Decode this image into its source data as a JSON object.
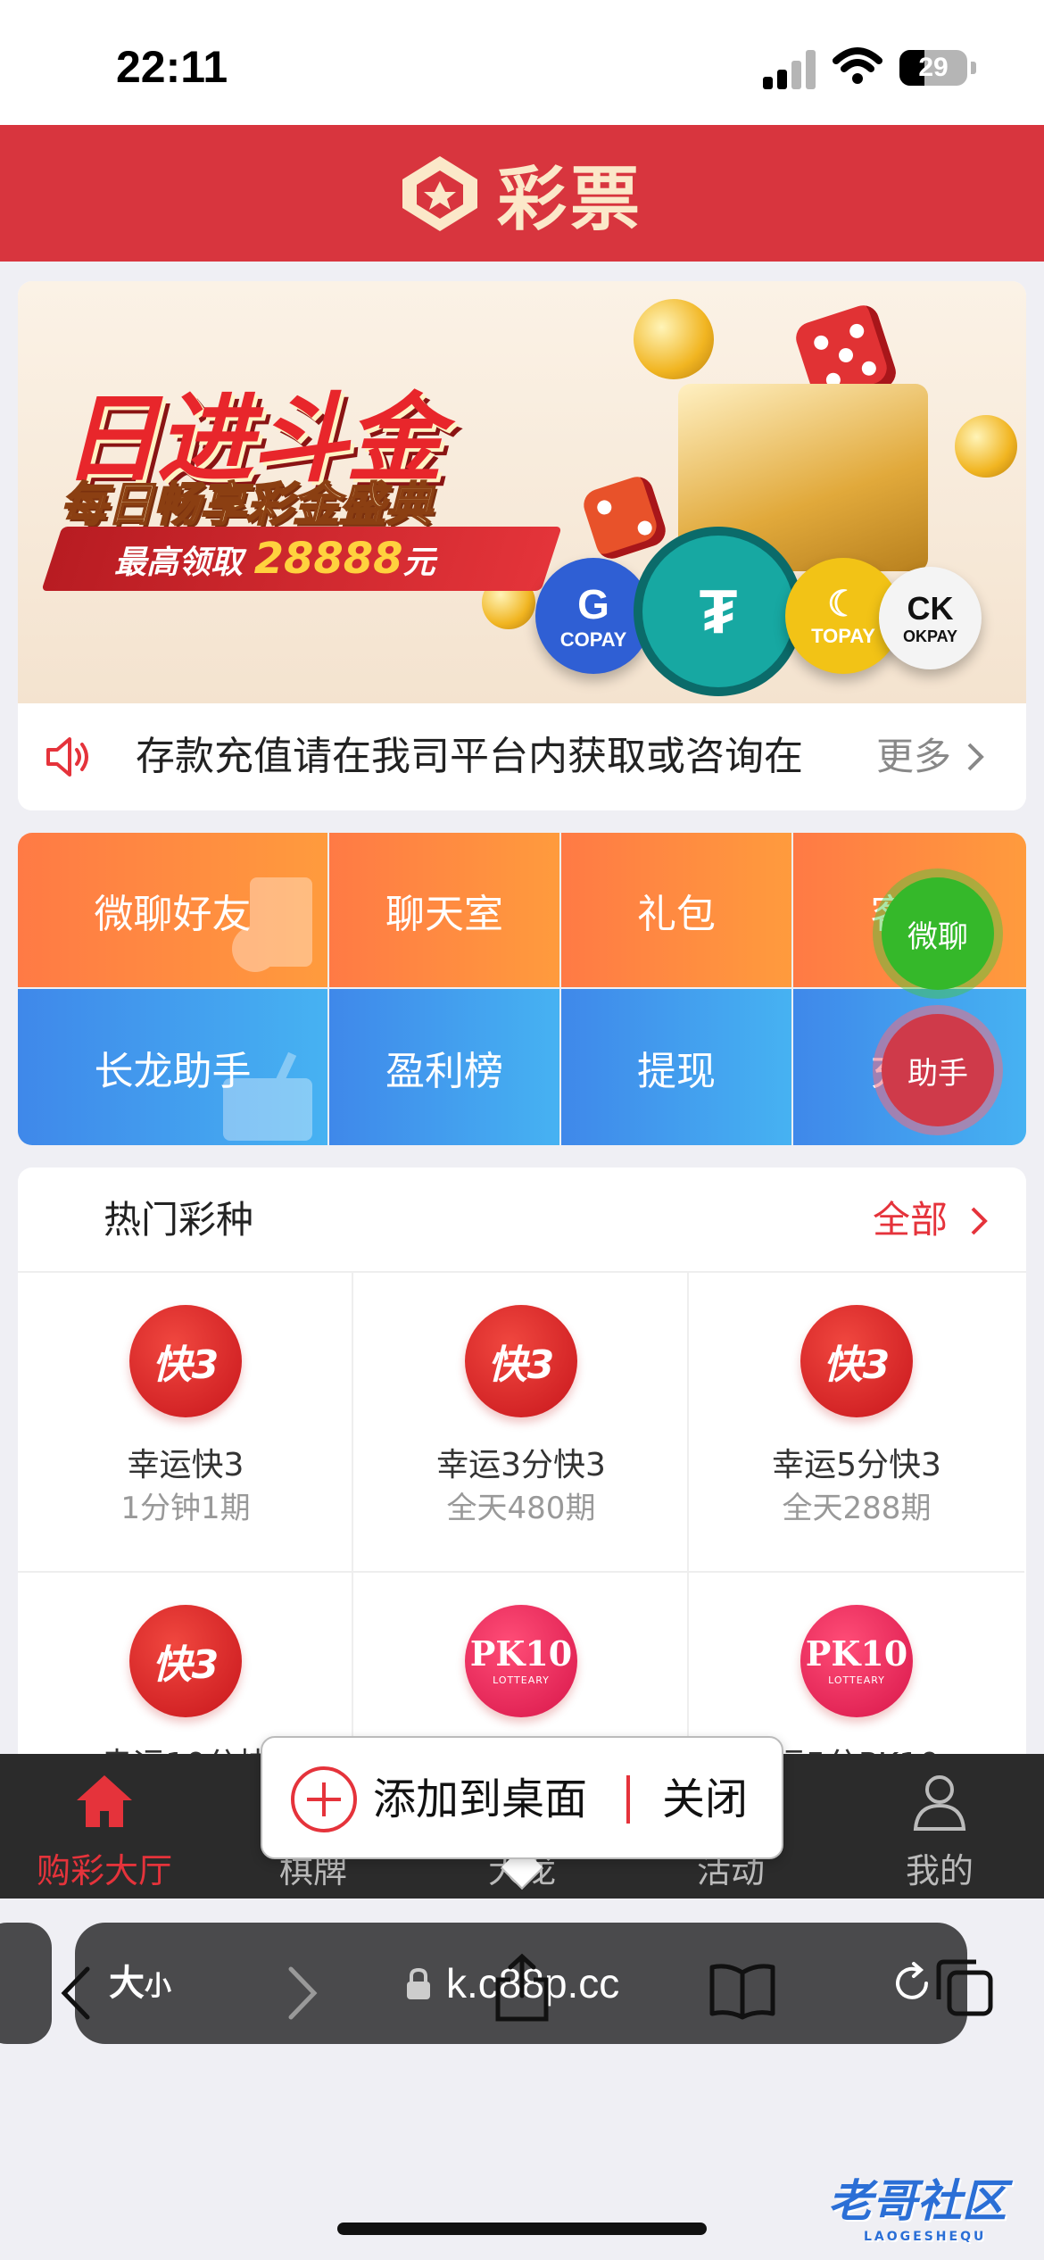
{
  "status_bar": {
    "time": "22:11",
    "battery": "29"
  },
  "header": {
    "title": "彩票"
  },
  "banner": {
    "headline": "日进斗金",
    "subline": "每日畅享彩金盛典",
    "ribbon_prefix": "最高领取",
    "ribbon_amount": "28888",
    "ribbon_unit": "元",
    "coins": [
      "COPAY",
      "TOPAY",
      "OKPAY"
    ]
  },
  "notice": {
    "text": "存款充值请在我司平台内获取或咨询在",
    "more": "更多"
  },
  "features": {
    "row1": [
      "微聊好友",
      "聊天室",
      "礼包",
      "客服"
    ],
    "row2": [
      "长龙助手",
      "盈利榜",
      "提现",
      "充值"
    ]
  },
  "floating": {
    "chat": "微聊",
    "assistant": "助手"
  },
  "hot": {
    "title": "热门彩种",
    "all": "全部",
    "games": [
      {
        "name": "幸运快3",
        "sub": "1分钟1期",
        "icon": "k3-icon"
      },
      {
        "name": "幸运3分快3",
        "sub": "全天480期",
        "icon": "k3-icon"
      },
      {
        "name": "幸运5分快3",
        "sub": "全天288期",
        "icon": "k3-icon"
      },
      {
        "name": "幸运10分快",
        "sub": "",
        "icon": "k3-icon"
      },
      {
        "name": "",
        "sub": "",
        "icon": "pk10-icon"
      },
      {
        "name": "运5分PK10",
        "sub": "",
        "icon": "pk10-icon"
      }
    ],
    "pk10_logo": "PK10",
    "pk10_small": "LOTTEARY"
  },
  "tabbar": {
    "tabs": [
      "购彩大厅",
      "棋牌",
      "大龙",
      "活动",
      "我的"
    ]
  },
  "add_prompt": {
    "add": "添加到桌面",
    "close": "关闭"
  },
  "safari": {
    "text_size": "大",
    "text_size_small": "小",
    "url": "k.c88p.cc"
  },
  "watermark": {
    "main": "老哥社区",
    "sub": "LAOGESHEQU"
  },
  "colors": {
    "brand_red": "#d8353e",
    "accent": "#e5333b",
    "orange": "#ff8a40",
    "blue": "#3f9ae8"
  }
}
